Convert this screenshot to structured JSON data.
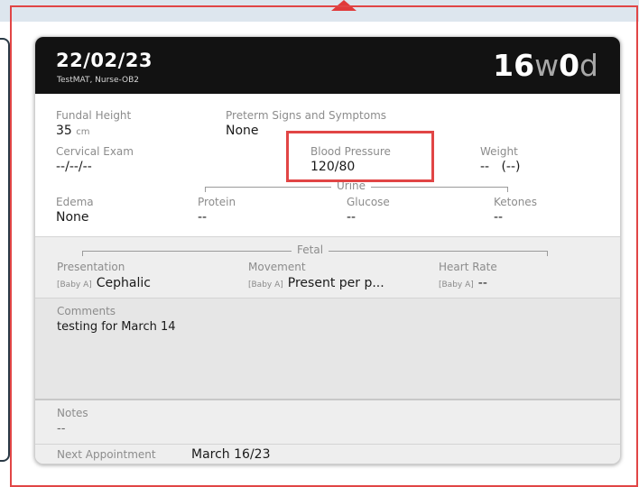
{
  "header": {
    "date": "22/02/23",
    "provider": "TestMAT, Nurse-OB2",
    "gestational_age": {
      "weeks": "16",
      "weeks_unit": "w",
      "days": "0",
      "days_unit": "d"
    }
  },
  "vitals": {
    "fundal_height": {
      "label": "Fundal Height",
      "value": "35",
      "unit": "cm"
    },
    "preterm": {
      "label": "Preterm Signs and Symptoms",
      "value": "None"
    },
    "cervical_exam": {
      "label": "Cervical Exam",
      "value": "--/--/--"
    },
    "blood_pressure": {
      "label": "Blood Pressure",
      "value": "120/80"
    },
    "weight": {
      "label": "Weight",
      "value": "--",
      "extra": "(--)"
    },
    "edema": {
      "label": "Edema",
      "value": "None"
    },
    "urine": {
      "label": "Urine",
      "protein": {
        "label": "Protein",
        "value": "--"
      },
      "glucose": {
        "label": "Glucose",
        "value": "--"
      },
      "ketones": {
        "label": "Ketones",
        "value": "--"
      }
    }
  },
  "fetal": {
    "label": "Fetal",
    "baby_tag": "[Baby A]",
    "presentation": {
      "label": "Presentation",
      "value": "Cephalic"
    },
    "movement": {
      "label": "Movement",
      "value": "Present per p..."
    },
    "heart_rate": {
      "label": "Heart Rate",
      "value": "--"
    }
  },
  "comments": {
    "label": "Comments",
    "value": "testing for March 14"
  },
  "notes": {
    "label": "Notes",
    "value": "--"
  },
  "next_appointment": {
    "label": "Next Appointment",
    "value": "March 16/23"
  },
  "colors": {
    "header_bg": "#121212",
    "highlight": "#e14545"
  }
}
